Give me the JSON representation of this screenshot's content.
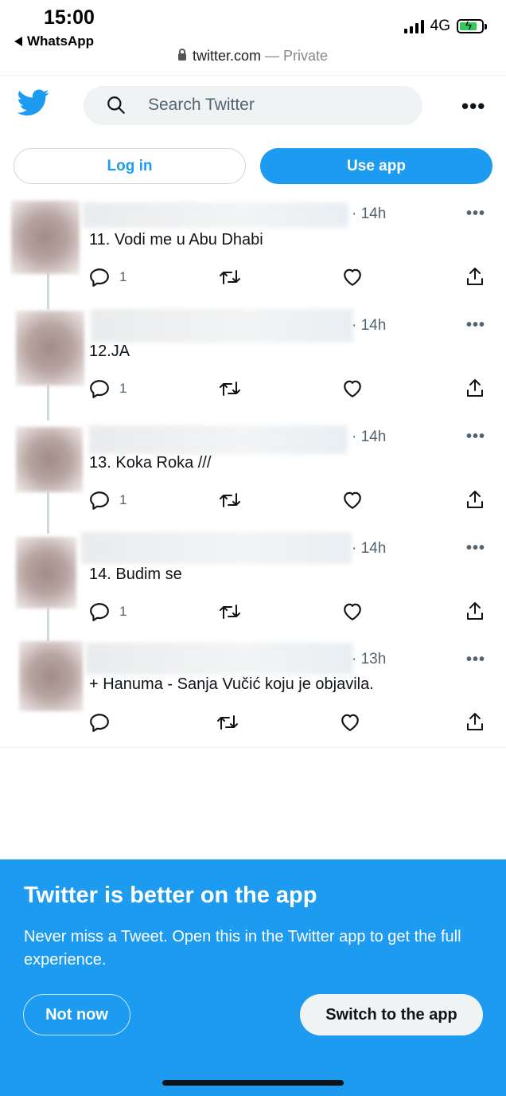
{
  "status_bar": {
    "time": "15:00",
    "back_app": "WhatsApp",
    "network": "4G"
  },
  "browser": {
    "domain": "twitter.com",
    "mode": "— Private"
  },
  "header": {
    "search_placeholder": "Search Twitter",
    "more_label": "•••"
  },
  "auth": {
    "login_label": "Log in",
    "use_app_label": "Use app"
  },
  "tweets": [
    {
      "time": "· 14h",
      "text": "11. Vodi me u Abu Dhabi",
      "replies": "1"
    },
    {
      "time": "· 14h",
      "text": "12.JA",
      "replies": "1"
    },
    {
      "time": "· 14h",
      "text": "13. Koka Roka ///",
      "replies": "1"
    },
    {
      "time": "· 14h",
      "text": "14. Budim se",
      "replies": "1"
    },
    {
      "time": "· 13h",
      "text": "+ Hanuma - Sanja Vučić koju je objavila.",
      "replies": ""
    }
  ],
  "banner": {
    "title": "Twitter is better on the app",
    "text": "Never miss a Tweet. Open this in the Twitter app to get the full experience.",
    "not_now_label": "Not now",
    "switch_label": "Switch to the app"
  },
  "colors": {
    "accent": "#1d9bf0",
    "secondary_text": "#536471",
    "search_bg": "#eff3f4"
  },
  "icons": [
    "twitter-bird-icon",
    "search-icon",
    "more-icon",
    "reply-icon",
    "retweet-icon",
    "like-icon",
    "share-icon",
    "lock-icon",
    "battery-icon",
    "signal-icon"
  ]
}
